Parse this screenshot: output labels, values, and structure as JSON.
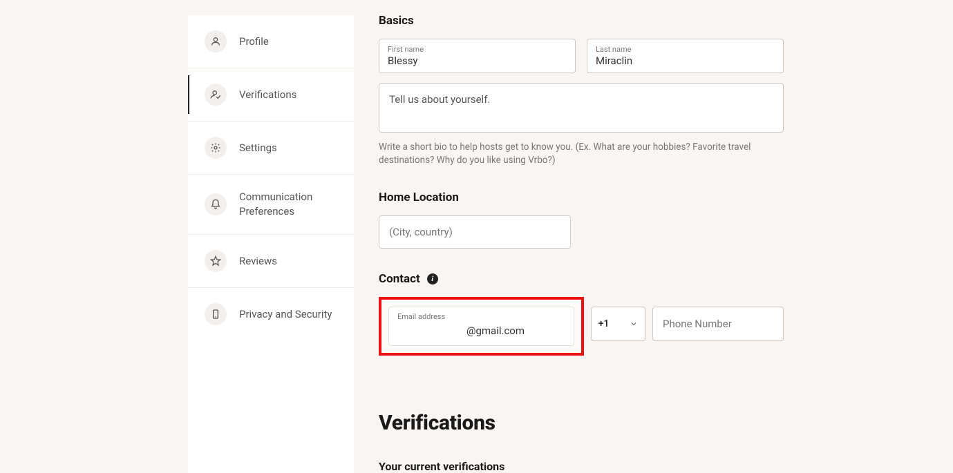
{
  "sidebar": {
    "items": [
      {
        "label": "Profile"
      },
      {
        "label": "Verifications"
      },
      {
        "label": "Settings"
      },
      {
        "label": "Communication Preferences"
      },
      {
        "label": "Reviews"
      },
      {
        "label": "Privacy and Security"
      }
    ]
  },
  "basics": {
    "heading": "Basics",
    "first_name_label": "First name",
    "first_name_value": "Blessy",
    "last_name_label": "Last name",
    "last_name_value": "Miraclin",
    "bio_placeholder": "Tell us about yourself.",
    "bio_help": "Write a short bio to help hosts get to know you. (Ex. What are your hobbies? Favorite travel destinations? Why do you like using Vrbo?)"
  },
  "home_location": {
    "heading": "Home Location",
    "placeholder": "(City, country)"
  },
  "contact": {
    "heading": "Contact",
    "email_label": "Email address",
    "email_value": "@gmail.com",
    "country_code": "+1",
    "phone_placeholder": "Phone Number"
  },
  "verifications": {
    "heading": "Verifications",
    "sub_heading": "Your current verifications"
  }
}
